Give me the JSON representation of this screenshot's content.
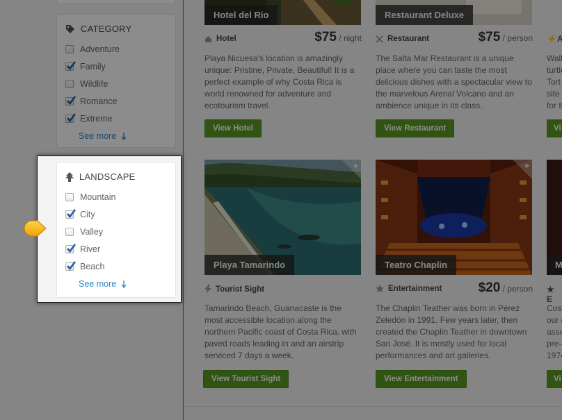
{
  "category": {
    "title": "CATEGORY",
    "options": [
      {
        "label": "Adventure",
        "checked": false
      },
      {
        "label": "Family",
        "checked": true
      },
      {
        "label": "Wildlife",
        "checked": false
      },
      {
        "label": "Romance",
        "checked": true
      },
      {
        "label": "Extreme",
        "checked": true
      }
    ],
    "see_more": "See more"
  },
  "landscape": {
    "title": "LANDSCAPE",
    "options": [
      {
        "label": "Mountain",
        "checked": false
      },
      {
        "label": "City",
        "checked": true
      },
      {
        "label": "Valley",
        "checked": false
      },
      {
        "label": "River",
        "checked": true
      },
      {
        "label": "Beach",
        "checked": true
      }
    ],
    "see_more": "See more"
  },
  "cards": [
    {
      "title": "Hotel del Rio",
      "type": "Hotel",
      "price": "$75",
      "unit": "/ night",
      "desc": "Playa Nicuesa's location is amazingly unique: Pristine, Private, Beautiful! It is a perfect example of why Costa Rica is world renowned for adventure and ecotourism travel.",
      "button": "View Hotel"
    },
    {
      "title": "Restaurant Deluxe",
      "type": "Restaurant",
      "price": "$75",
      "unit": "/ person",
      "desc": "The Salta Mar Restaurant is a unique place where you can taste the most delicious dishes with a spectacular view to the marvelous Arenal Volcano and an ambience unique in its class.",
      "button": "View Restaurant"
    },
    {
      "title": "Playa Tamarindo",
      "type": "Tourist Sight",
      "desc": "Tamarindo Beach, Guanacaste is the most accessible location along the northern Pacific coast of Costa Rica. with paved roads leading in and an airstrip serviced 7 days a week.",
      "button": "View Tourist Sight"
    },
    {
      "title": "Teatro Chaplin",
      "type": "Entertainment",
      "price": "$20",
      "unit": "/ person",
      "desc": "The Chaplin Teather was born in Pérez Zeledón in 1991. Few years later, then created the Chaplin Teather in downtown San José. It is mostly used for local performances and art galleries.",
      "button": "View Entertainment"
    }
  ],
  "partial_cards": {
    "top_type_initial": "A",
    "top_desc": [
      "Walk",
      "turtle",
      "Tort",
      "site",
      "for th"
    ],
    "top_button": "Vi",
    "bottom_title": "M",
    "bottom_type_initial": "E",
    "bottom_desc": [
      "Cost",
      "our c",
      "asse",
      "pre-",
      "1974"
    ],
    "bottom_button": "Vi"
  }
}
